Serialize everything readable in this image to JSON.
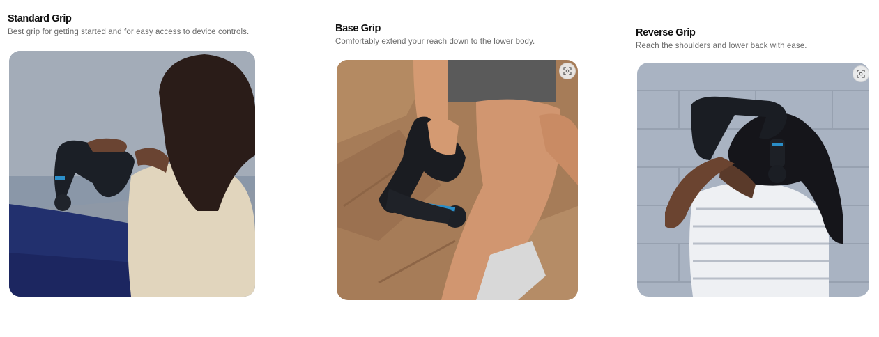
{
  "cards": [
    {
      "title": "Standard Grip",
      "description": "Best grip for getting started and for easy access to device controls."
    },
    {
      "title": "Base Grip",
      "description": "Comfortably extend your reach down to the lower body."
    },
    {
      "title": "Reverse Grip",
      "description": "Reach the shoulders and lower back with ease."
    }
  ],
  "icons": {
    "zoom": "expand-zoom-icon"
  }
}
